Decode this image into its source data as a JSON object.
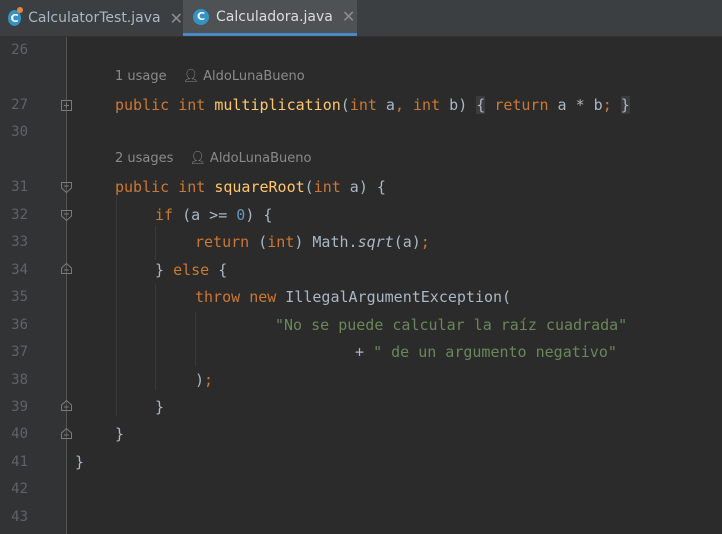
{
  "tabs": [
    {
      "label": "CalculatorTest.java",
      "close": "✕"
    },
    {
      "label": "Calculadora.java",
      "close": "✕"
    }
  ],
  "hints": {
    "multiplication_usage": "1 usage",
    "multiplication_author": "AldoLunaBueno",
    "squareRoot_usage": "2 usages",
    "squareRoot_author": "AldoLunaBueno"
  },
  "line_numbers": [
    "26",
    "27",
    "30",
    "31",
    "32",
    "33",
    "34",
    "35",
    "36",
    "37",
    "38",
    "39",
    "40",
    "41",
    "42",
    "43"
  ],
  "code": {
    "l27": {
      "mod": "public",
      "type": "int",
      "name": "multiplication",
      "params_open": "(",
      "ptype1": "int",
      "p1": " a",
      "comma": ", ",
      "ptype2": "int",
      "p2": " b",
      "close": ") ",
      "lbrace": "{",
      "ret": "return",
      "expr": " a * b",
      "semi": ";",
      "rbrace": "}"
    },
    "l31": {
      "mod": "public",
      "type": "int",
      "name": "squareRoot",
      "open": "(",
      "ptype": "int",
      "rest": " a) {"
    },
    "l32": {
      "kw": "if",
      "pre": " (a >= ",
      "num": "0",
      "post": ") {"
    },
    "l33": {
      "kw": "return",
      "pre": " (",
      "type": "int",
      "mid": ") Math.",
      "fn": "sqrt",
      "post": "(a)",
      "semi": ";"
    },
    "l34": {
      "pre": "} ",
      "kw": "else",
      "post": " {"
    },
    "l35": {
      "kw1": "throw",
      "kw2": "new",
      "rest": " IllegalArgumentException("
    },
    "l36": {
      "str": "\"No se puede calcular la raíz cuadrada\""
    },
    "l37": {
      "op": "+ ",
      "str": "\" de un argumento negativo\""
    },
    "l38": {
      "paren": ")",
      "semi": ";"
    },
    "l39": {
      "brace": "}"
    },
    "l40": {
      "brace": "}"
    },
    "l41": {
      "brace": "}"
    }
  }
}
